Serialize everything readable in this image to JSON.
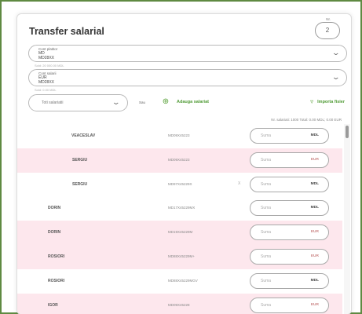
{
  "header": {
    "title": "Transfer salarial",
    "row_count_label": "Nr.",
    "row_count_value": "2"
  },
  "fields": {
    "payer": {
      "label": "Cont platitor",
      "value1": "MD",
      "value2": "MD28XX",
      "hint": "Sold: 20 000.00 MDL"
    },
    "beneficiary": {
      "label": "Cont salarii",
      "value1": "EUR",
      "value2": "MD28XX",
      "hint": "Sold: 0.00 MDL"
    }
  },
  "toolbar": {
    "select_placeholder": "Toti salariatii",
    "sau_label": "Sau",
    "add_label": "Adauga salariat",
    "import_label": "Importa fisier"
  },
  "totals": {
    "text": "Nr. salariati: 1000   Total: 0.00 MDL; 0.00 EUR"
  },
  "table": {
    "amount_placeholder": "Suma",
    "rows": [
      {
        "name": "VEACESLAV",
        "account": "MD09X45223",
        "currency": "MDL",
        "pink": false,
        "indent": 69,
        "x": ""
      },
      {
        "name": "SERGIU",
        "account": "MD09X45223",
        "currency": "EUR",
        "pink": true,
        "indent": 70,
        "x": ""
      },
      {
        "name": "SERGIU",
        "account": "MD97X45229X",
        "currency": "MDL",
        "pink": false,
        "indent": 70,
        "x": "X"
      },
      {
        "name": "DORIN",
        "account": "MD17X45229MX",
        "currency": "MDL",
        "pink": false,
        "indent": 39,
        "x": ""
      },
      {
        "name": "DORIN",
        "account": "MD19X45229M",
        "currency": "EUR",
        "pink": true,
        "indent": 39,
        "x": ""
      },
      {
        "name": "ROSIORI",
        "account": "MD88X45229M+",
        "currency": "EUR",
        "pink": true,
        "indent": 39,
        "x": ""
      },
      {
        "name": "ROSIORI",
        "account": "MD88X45229MGV",
        "currency": "MDL",
        "pink": false,
        "indent": 39,
        "x": ""
      },
      {
        "name": "IGOR",
        "account": "MD09X45228",
        "currency": "EUR",
        "pink": true,
        "indent": 39,
        "x": ""
      }
    ]
  }
}
